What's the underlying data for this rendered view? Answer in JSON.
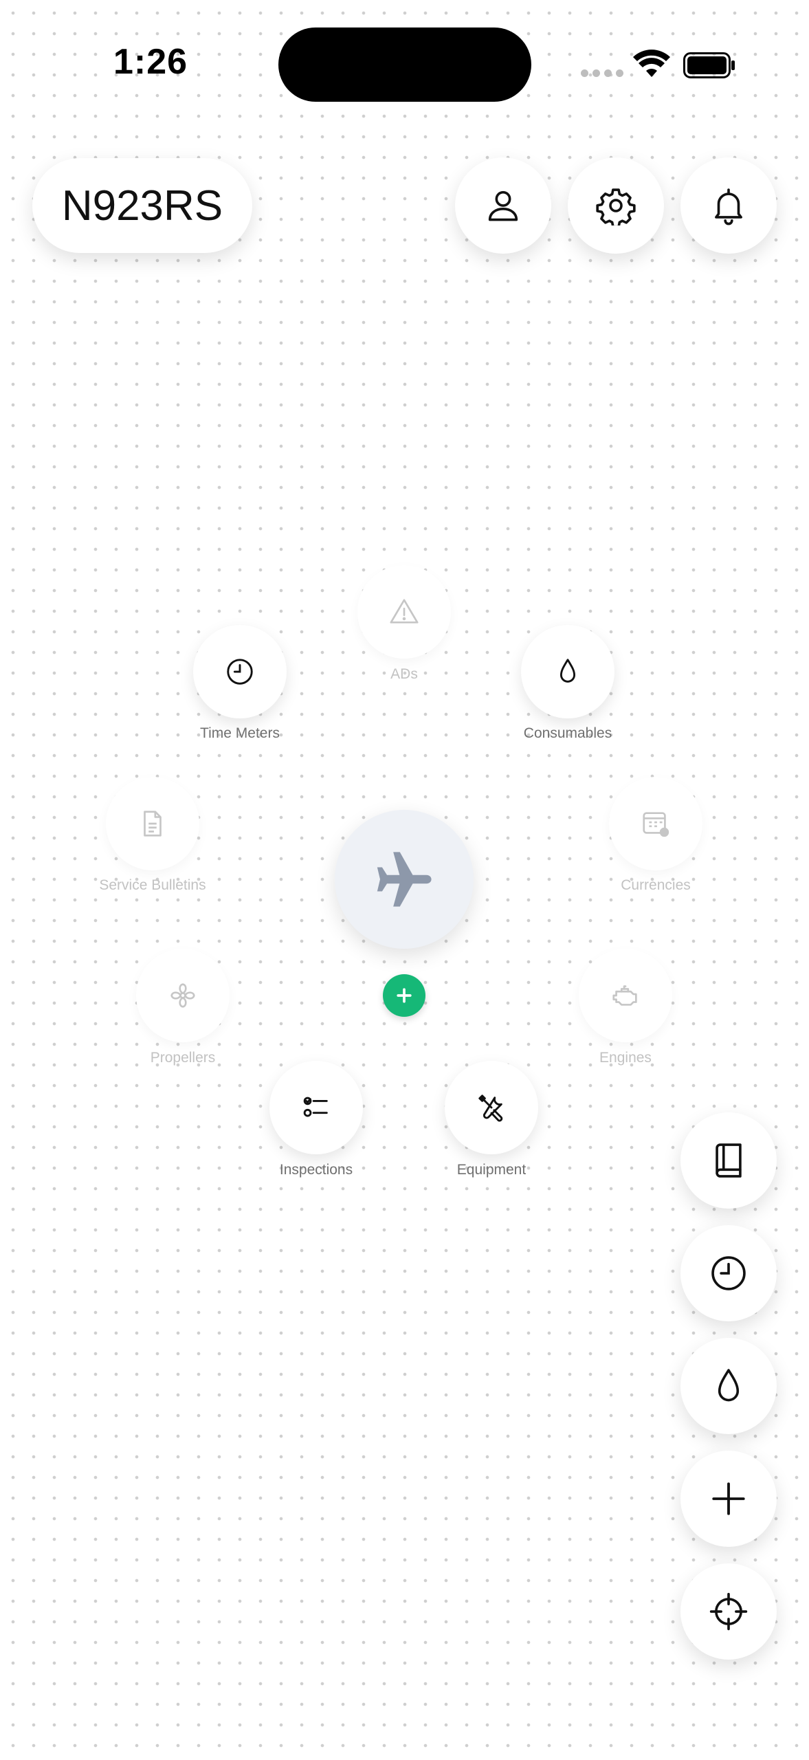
{
  "status_bar": {
    "time": "1:26"
  },
  "header": {
    "tail_number": "N923RS"
  },
  "top_actions": [
    {
      "name": "profile",
      "icon": "user-icon"
    },
    {
      "name": "settings",
      "icon": "gear-icon"
    },
    {
      "name": "notifications",
      "icon": "bell-icon"
    }
  ],
  "hub": {
    "icon": "airplane-icon",
    "add_icon": "plus-icon",
    "accent": "#16b877"
  },
  "nodes": {
    "ads": {
      "label": "ADs",
      "icon": "warning-icon",
      "active": false
    },
    "time_meters": {
      "label": "Time Meters",
      "icon": "clock-icon",
      "active": true
    },
    "consumables": {
      "label": "Consumables",
      "icon": "drop-icon",
      "active": true
    },
    "service_bulletins": {
      "label": "Service Bulletins",
      "icon": "document-icon",
      "active": false
    },
    "currencies": {
      "label": "Currencies",
      "icon": "calendar-icon",
      "active": false
    },
    "propellers": {
      "label": "Propellers",
      "icon": "fan-icon",
      "active": false
    },
    "engines": {
      "label": "Engines",
      "icon": "engine-icon",
      "active": false
    },
    "inspections": {
      "label": "Inspections",
      "icon": "checklist-icon",
      "active": true
    },
    "equipment": {
      "label": "Equipment",
      "icon": "tools-icon",
      "active": true
    }
  },
  "side_actions": [
    {
      "name": "logbook",
      "icon": "book-icon"
    },
    {
      "name": "time",
      "icon": "clock-icon"
    },
    {
      "name": "fuel",
      "icon": "drop-icon"
    },
    {
      "name": "add",
      "icon": "plus-icon"
    },
    {
      "name": "locate",
      "icon": "crosshair-icon"
    }
  ]
}
